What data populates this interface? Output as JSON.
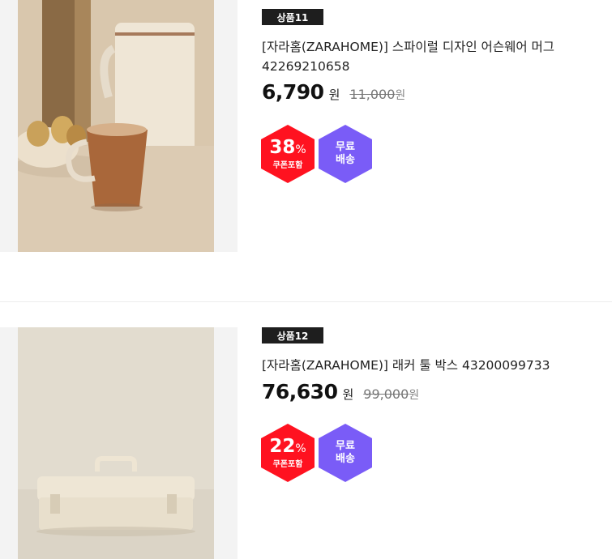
{
  "products": [
    {
      "rank": "상품11",
      "title": "[자라홈(ZARAHOME)] 스파이럴 디자인 어슨웨어 머그 42269210658",
      "price": "6,790",
      "currency": "원",
      "original_price": "11,000",
      "original_currency": "원",
      "discount_percent": "38",
      "percent_sign": "%",
      "coupon_label": "쿠폰포함",
      "shipping_line1": "무료",
      "shipping_line2": "배송"
    },
    {
      "rank": "상품12",
      "title": "[자라홈(ZARAHOME)] 래커 툴 박스 43200099733",
      "price": "76,630",
      "currency": "원",
      "original_price": "99,000",
      "original_currency": "원",
      "discount_percent": "22",
      "percent_sign": "%",
      "coupon_label": "쿠폰포함",
      "shipping_line1": "무료",
      "shipping_line2": "배송"
    }
  ],
  "colors": {
    "discount_badge": "#ff1220",
    "shipping_badge": "#7a5cf7",
    "rank_badge": "#1e1e1e"
  }
}
